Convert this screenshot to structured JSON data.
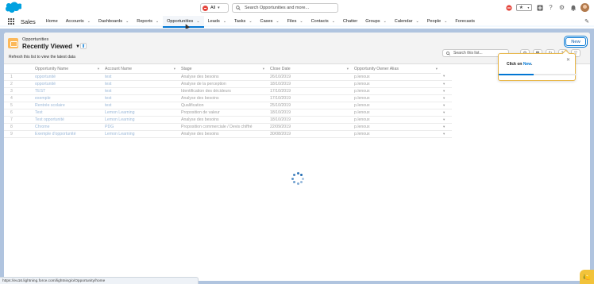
{
  "header": {
    "search_scope": "All",
    "search_placeholder": "Search Opportunities and more...",
    "icons": [
      "salesforce-cloud-logo",
      "help-icon",
      "gear-icon",
      "bell-icon",
      "add-icon",
      "favorites-icon"
    ]
  },
  "nav": {
    "app_name": "Sales",
    "items": [
      {
        "label": "Home",
        "has_menu": false
      },
      {
        "label": "Accounts",
        "has_menu": true
      },
      {
        "label": "Dashboards",
        "has_menu": true
      },
      {
        "label": "Reports",
        "has_menu": true
      },
      {
        "label": "Opportunities",
        "has_menu": true,
        "active": true
      },
      {
        "label": "Leads",
        "has_menu": true
      },
      {
        "label": "Tasks",
        "has_menu": true
      },
      {
        "label": "Cases",
        "has_menu": true
      },
      {
        "label": "Files",
        "has_menu": true
      },
      {
        "label": "Contacts",
        "has_menu": true
      },
      {
        "label": "Chatter",
        "has_menu": false
      },
      {
        "label": "Groups",
        "has_menu": true
      },
      {
        "label": "Calendar",
        "has_menu": true
      },
      {
        "label": "People",
        "has_menu": true
      },
      {
        "label": "Forecasts",
        "has_menu": false
      }
    ]
  },
  "list": {
    "object_label": "Opportunities",
    "view_name": "Recently Viewed",
    "refresh_message": "Refresh this list to view the latest data",
    "new_button": "New",
    "search_placeholder": "Search this list...",
    "columns": [
      "Opportunity Name",
      "Account Name",
      "Stage",
      "Close Date",
      "Opportunity Owner Alias"
    ],
    "rows": [
      {
        "num": "1",
        "name": "opportunité",
        "account": "test",
        "stage": "Analyse des besoins",
        "close": "26/10/2019",
        "owner": "p.lenoux"
      },
      {
        "num": "2",
        "name": "opportunité",
        "account": "test",
        "stage": "Analyse de la perception",
        "close": "18/10/2019",
        "owner": "p.lenoux"
      },
      {
        "num": "3",
        "name": "TEST",
        "account": "test",
        "stage": "Identification des décideurs",
        "close": "17/10/2019",
        "owner": "p.lenoux"
      },
      {
        "num": "4",
        "name": "exemple",
        "account": "test",
        "stage": "Analyse des besoins",
        "close": "17/10/2019",
        "owner": "p.lenoux"
      },
      {
        "num": "5",
        "name": "Rentrée scolaire",
        "account": "test",
        "stage": "Qualification",
        "close": "25/10/2019",
        "owner": "p.lenoux"
      },
      {
        "num": "6",
        "name": "Test",
        "account": "Lemon Learning",
        "stage": "Proposition de valeur",
        "close": "18/10/2019",
        "owner": "p.lenoux"
      },
      {
        "num": "7",
        "name": "Test opportunité",
        "account": "Lemon Learning",
        "stage": "Analyse des besoins",
        "close": "18/10/2019",
        "owner": "p.lenoux"
      },
      {
        "num": "8",
        "name": "Chrome",
        "account": "PDG",
        "stage": "Proposition commerciale / Devis chiffré",
        "close": "22/09/2019",
        "owner": "p.lenoux"
      },
      {
        "num": "9",
        "name": "Exemple d'opportunité",
        "account": "Lemon Learning",
        "stage": "Analyse des besoins",
        "close": "30/08/2019",
        "owner": "p.lenoux"
      }
    ]
  },
  "guide_popover": {
    "text_prefix": "Click on ",
    "target": "New",
    "text_suffix": ".",
    "progress": 0.45
  },
  "status_url": "https://eu16.lightning.force.com/lightning/o/Opportunity/home",
  "colors": {
    "brand": "#0176d3",
    "overlay": "#b0c4df",
    "popover_border": "#e8b74a"
  }
}
